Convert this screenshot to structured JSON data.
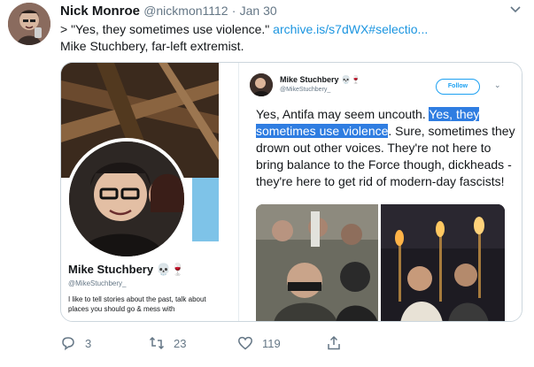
{
  "tweet": {
    "author_name": "Nick Monroe",
    "author_handle": "@nickmon1112",
    "separator": "·",
    "date": "Jan 30",
    "quote_prefix": "> \"Yes, they sometimes use violence.\" ",
    "link_text": "archive.is/s7dWX#selectio...",
    "second_line": "Mike Stuchbery, far-left extremist.",
    "actions": {
      "reply_count": "3",
      "retweet_count": "23",
      "like_count": "119"
    }
  },
  "media": {
    "profile": {
      "name": "Mike Stuchbery 💀🍷",
      "handle": "@MikeStuchbery_",
      "bio": "I like to tell stories about the past, talk about places you should go & mess with"
    },
    "embed": {
      "name": "Mike Stuchbery 💀🍷",
      "handle": "@MikeStuchbery_",
      "follow_label": "Follow",
      "text_before": "Yes, Antifa may seem uncouth. ",
      "text_highlight": "Yes, they sometimes use violence",
      "text_after": ". Sure, sometimes they drown out other voices. They're not here to bring balance to the Force though, dickheads - they're here to get rid of modern-day fascists!"
    }
  },
  "colors": {
    "link": "#1b95e0",
    "highlight": "#2f7de1",
    "muted": "#657786",
    "follow": "#1da1f2"
  },
  "icons": [
    "caret-down-icon",
    "reply-icon",
    "retweet-icon",
    "like-icon",
    "share-icon",
    "verified-icon"
  ]
}
